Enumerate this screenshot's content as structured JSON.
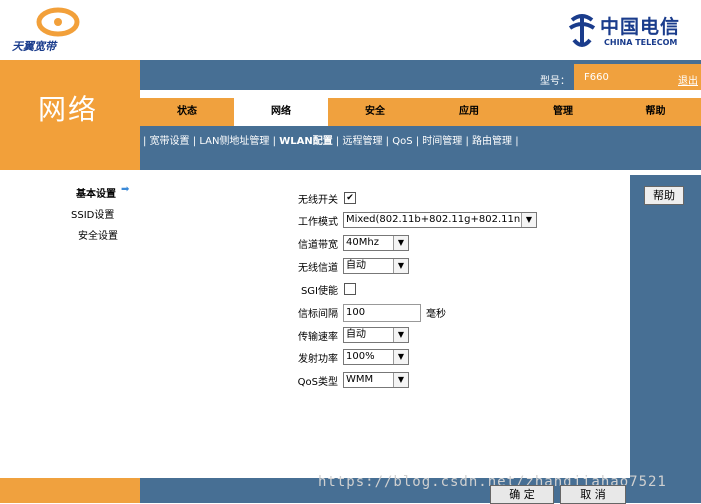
{
  "brand": {
    "name": "天翼宽带",
    "provider_name": "中国电信",
    "provider_sub": "CHINA TELECOM"
  },
  "section_title": "网络",
  "topbar": {
    "model_label": "型号：",
    "model_value": "F660",
    "logout": "退出"
  },
  "tabs": [
    {
      "label": "状态",
      "active": false
    },
    {
      "label": "网络",
      "active": true
    },
    {
      "label": "安全",
      "active": false
    },
    {
      "label": "应用",
      "active": false
    },
    {
      "label": "管理",
      "active": false
    },
    {
      "label": "帮助",
      "active": false
    }
  ],
  "subnav": [
    {
      "label": "宽带设置",
      "active": false
    },
    {
      "label": "LAN侧地址管理",
      "active": false
    },
    {
      "label": "WLAN配置",
      "active": true
    },
    {
      "label": "远程管理",
      "active": false
    },
    {
      "label": "QoS",
      "active": false
    },
    {
      "label": "时间管理",
      "active": false
    },
    {
      "label": "路由管理",
      "active": false
    }
  ],
  "sidebar": {
    "items": [
      {
        "label": "基本设置",
        "active": true
      },
      {
        "label": "SSID设置",
        "active": false
      },
      {
        "label": "安全设置",
        "active": false
      }
    ]
  },
  "form": {
    "wireless_switch": {
      "label": "无线开关",
      "checked": true
    },
    "work_mode": {
      "label": "工作模式",
      "value": "Mixed(802.11b+802.11g+802.11n"
    },
    "bandwidth": {
      "label": "信道带宽",
      "value": "40Mhz"
    },
    "channel": {
      "label": "无线信道",
      "value": "自动"
    },
    "sgi": {
      "label": "SGI使能",
      "checked": false
    },
    "beacon": {
      "label": "信标间隔",
      "value": "100",
      "unit": "毫秒"
    },
    "rate": {
      "label": "传输速率",
      "value": "自动"
    },
    "power": {
      "label": "发射功率",
      "value": "100%"
    },
    "qos": {
      "label": "QoS类型",
      "value": "WMM"
    }
  },
  "buttons": {
    "help": "帮助",
    "ok": "确 定",
    "cancel": "取 消"
  },
  "watermark": "https://blog.csdn.net/zhangjiahao7521",
  "colors": {
    "orange": "#f0a13e",
    "steel_blue": "#476f94",
    "brand_blue": "#1a3c8c"
  }
}
